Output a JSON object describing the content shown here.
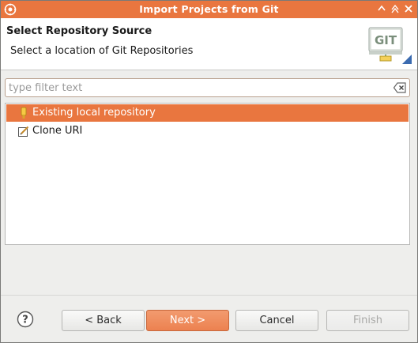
{
  "window": {
    "title": "Import Projects from Git",
    "controls": [
      "minimize-icon",
      "maximize-icon",
      "close-icon"
    ]
  },
  "header": {
    "title": "Select Repository Source",
    "description": "Select a location of Git Repositories",
    "logo_text": "GIT"
  },
  "filter": {
    "value": "",
    "placeholder": "type filter text"
  },
  "list": {
    "items": [
      {
        "label": "Existing local repository",
        "icon": "local-repository-icon",
        "selected": true
      },
      {
        "label": "Clone URI",
        "icon": "clone-uri-icon",
        "selected": false
      }
    ]
  },
  "buttons": {
    "back": "< Back",
    "next": "Next >",
    "cancel": "Cancel",
    "finish": "Finish"
  },
  "colors": {
    "accent": "#e9763f",
    "selection": "#e9763f"
  }
}
